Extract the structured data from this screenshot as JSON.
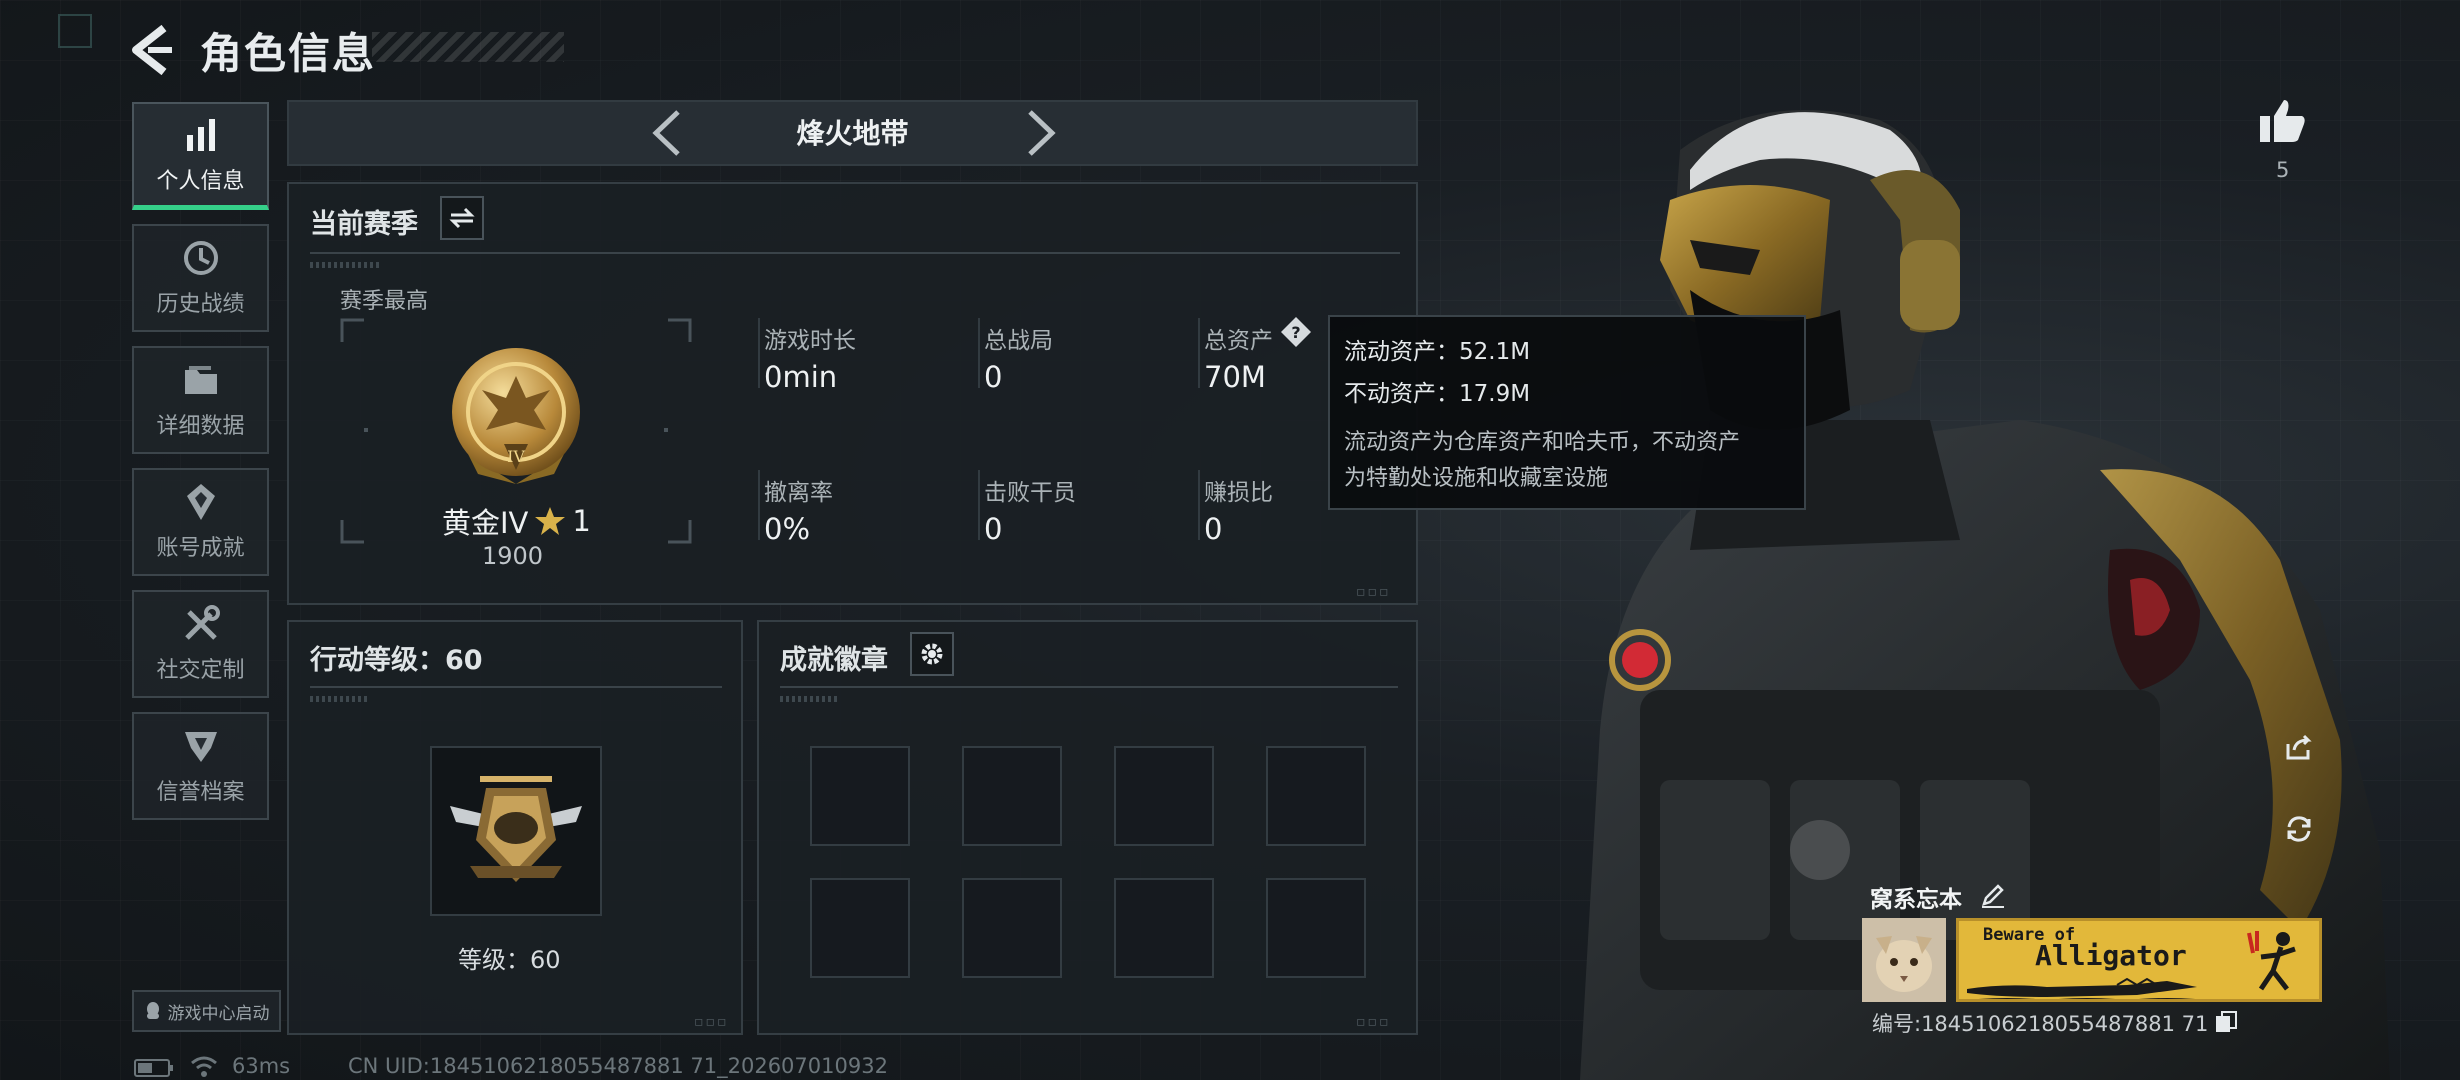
{
  "header": {
    "title": "角色信息"
  },
  "sidebar": {
    "items": [
      {
        "label": "个人信息",
        "icon": "bar-chart-icon",
        "active": true
      },
      {
        "label": "历史战绩",
        "icon": "clock-icon",
        "active": false
      },
      {
        "label": "详细数据",
        "icon": "folder-icon",
        "active": false
      },
      {
        "label": "账号成就",
        "icon": "achievement-icon",
        "active": false
      },
      {
        "label": "社交定制",
        "icon": "tools-icon",
        "active": false
      },
      {
        "label": "信誉档案",
        "icon": "shield-icon",
        "active": false
      }
    ],
    "game_center": "游戏中心启动"
  },
  "status": {
    "ping": "63ms",
    "uid": "CN UID:1845106218055487881 71_202607010932"
  },
  "mode": {
    "title": "烽火地带"
  },
  "season": {
    "heading": "当前赛季",
    "best_label": "赛季最高",
    "rank_name": "黄金IV",
    "rank_stars": "1",
    "rank_score": "1900",
    "stats": [
      {
        "label": "游戏时长",
        "value": "0min"
      },
      {
        "label": "总战局",
        "value": "0"
      },
      {
        "label": "总资产",
        "value": "70M"
      },
      {
        "label": "撤离率",
        "value": "0%"
      },
      {
        "label": "击败干员",
        "value": "0"
      },
      {
        "label": "赚损比",
        "value": "0"
      }
    ]
  },
  "tooltip": {
    "liquid": "流动资产：52.1M",
    "fixed": "不动资产：17.9M",
    "desc_line1": "流动资产为仓库资产和哈夫币，不动资产",
    "desc_line2": "为特勤处设施和收藏室设施"
  },
  "level": {
    "heading": "行动等级：60",
    "label": "等级：60"
  },
  "achievements": {
    "heading": "成就徽章",
    "slots": 8
  },
  "profile": {
    "likes": "5",
    "name": "窝系忘本",
    "banner_small": "Beware of",
    "banner_big": "Alligator",
    "uid_line": "编号:1845106218055487881 71"
  },
  "colors": {
    "accent": "#35d08a",
    "banner": "#e2b83a"
  }
}
